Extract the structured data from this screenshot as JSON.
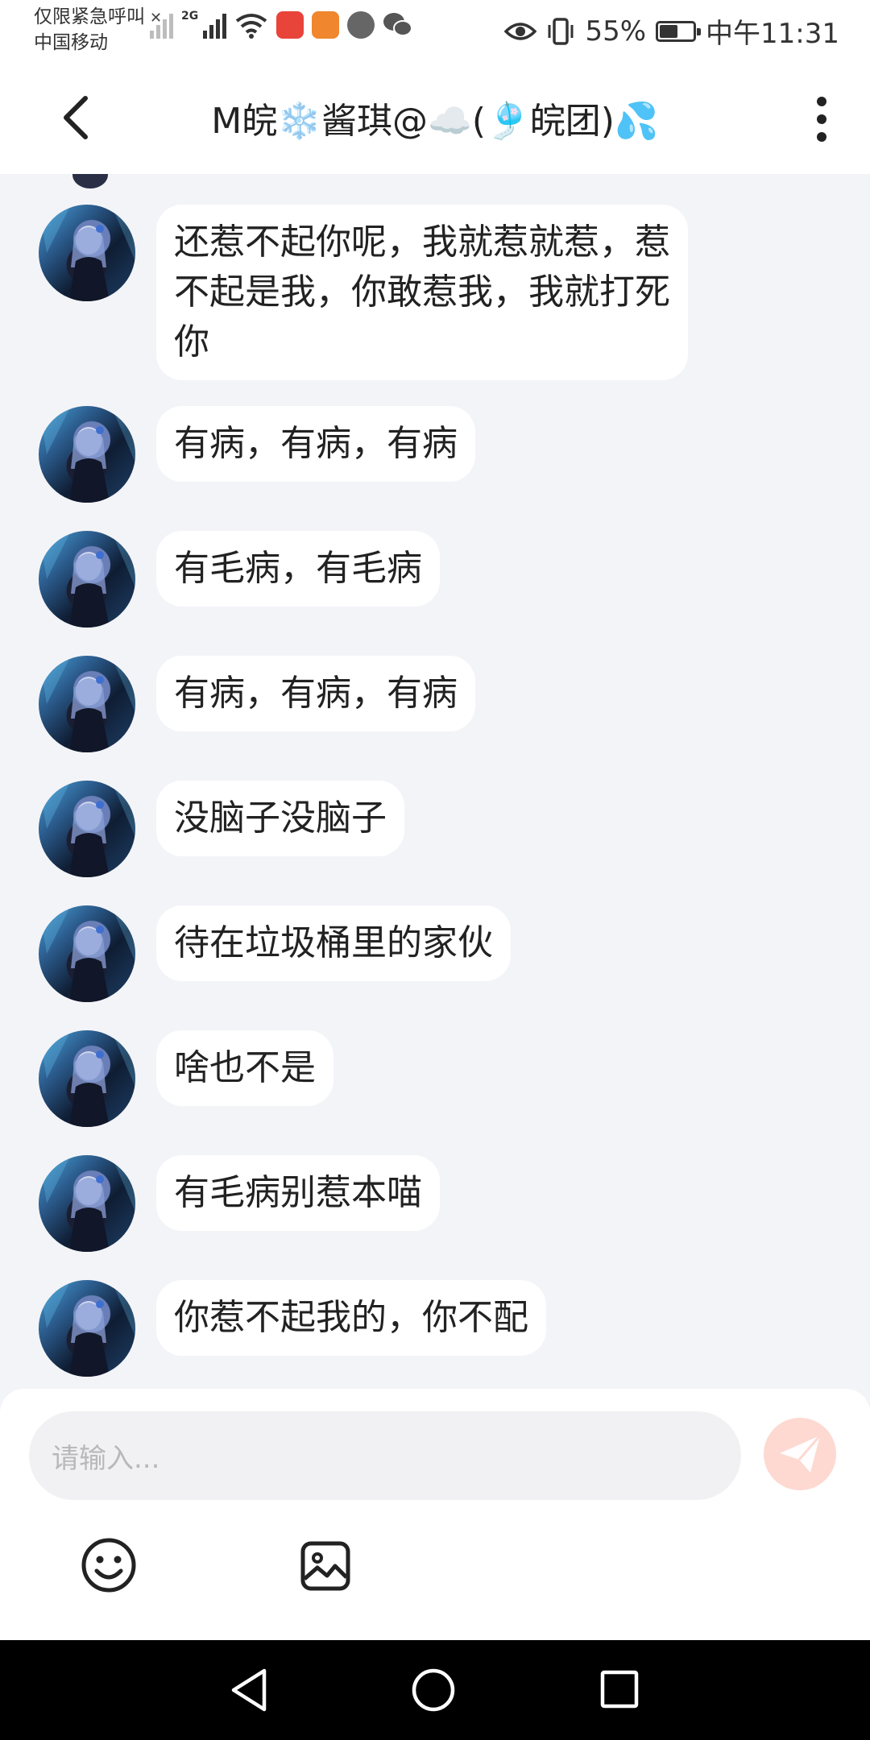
{
  "status_bar": {
    "carrier_line1": "仅限紧急呼叫",
    "carrier_line2": "中国移动",
    "network_type": "2G",
    "battery_percent": "55%",
    "battery_level": 0.55,
    "time": "中午11:31"
  },
  "header": {
    "title": "M皖❄️酱琪@☁️(🎐皖团)💦"
  },
  "messages": [
    {
      "sender": "other",
      "lines": [
        "还惹不起你呢，我就惹就惹，惹",
        "不起是我，你敢惹我，我就打死",
        "你"
      ]
    },
    {
      "sender": "other",
      "lines": [
        "有病，有病，有病"
      ]
    },
    {
      "sender": "other",
      "lines": [
        "有毛病，有毛病"
      ]
    },
    {
      "sender": "other",
      "lines": [
        "有病，有病，有病"
      ]
    },
    {
      "sender": "other",
      "lines": [
        "没脑子没脑子"
      ]
    },
    {
      "sender": "other",
      "lines": [
        "待在垃圾桶里的家伙"
      ]
    },
    {
      "sender": "other",
      "lines": [
        "啥也不是"
      ]
    },
    {
      "sender": "other",
      "lines": [
        "有毛病别惹本喵"
      ]
    },
    {
      "sender": "other",
      "lines": [
        "你惹不起我的，你不配"
      ]
    }
  ],
  "composer": {
    "placeholder": "请输入...",
    "send_icon": "paper-plane-icon",
    "emoji_icon": "smiley-icon",
    "image_icon": "image-icon"
  },
  "colors": {
    "chat_background": "#f3f4f8",
    "bubble": "#ffffff",
    "send_button": "#fdd9d2",
    "nav_bar": "#000000"
  }
}
